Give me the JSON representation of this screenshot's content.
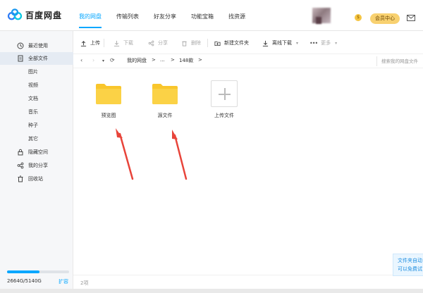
{
  "app": {
    "name": "百度网盘"
  },
  "topnav": {
    "items": [
      {
        "label": "我的网盘",
        "active": true
      },
      {
        "label": "传输列表",
        "active": false
      },
      {
        "label": "好友分享",
        "active": false
      },
      {
        "label": "功能宝箱",
        "active": false
      },
      {
        "label": "找资源",
        "active": false
      }
    ]
  },
  "header": {
    "vip_badge": "$",
    "vip_button": "会员中心"
  },
  "sidebar": {
    "items": [
      {
        "label": "最近使用",
        "icon": "clock-icon"
      },
      {
        "label": "全部文件",
        "icon": "file-icon",
        "active": true
      },
      {
        "label": "图片"
      },
      {
        "label": "视频"
      },
      {
        "label": "文档"
      },
      {
        "label": "音乐"
      },
      {
        "label": "种子"
      },
      {
        "label": "其它"
      },
      {
        "label": "隐藏空间",
        "icon": "lock-icon"
      },
      {
        "label": "我的分享",
        "icon": "share-icon"
      },
      {
        "label": "回收站",
        "icon": "trash-icon"
      }
    ],
    "storage": {
      "text": "2664G/5140G",
      "used_fraction": 0.518,
      "expand": "扩容"
    }
  },
  "toolbar": {
    "upload": "上传",
    "download": "下载",
    "share": "分享",
    "delete": "删除",
    "new_folder": "新建文件夹",
    "offline_download": "离线下载",
    "more": "更多"
  },
  "pathbar": {
    "root": "我的网盘",
    "sep1": ">",
    "ellipsis": "...",
    "sep2": ">",
    "current": "148款",
    "sep3": ">",
    "search_placeholder": "搜索我的网盘文件"
  },
  "files": [
    {
      "name": "预览图",
      "type": "folder"
    },
    {
      "name": "源文件",
      "type": "folder"
    },
    {
      "name": "上传文件",
      "type": "upload"
    }
  ],
  "footer": {
    "count": "2项"
  },
  "float_tip": {
    "line1": "文件夹自动",
    "line2": "可以免费试"
  },
  "colors": {
    "accent": "#06a7ff",
    "folder": "#f9c62c",
    "arrow": "#e8443a",
    "vip": "#f8d170"
  }
}
